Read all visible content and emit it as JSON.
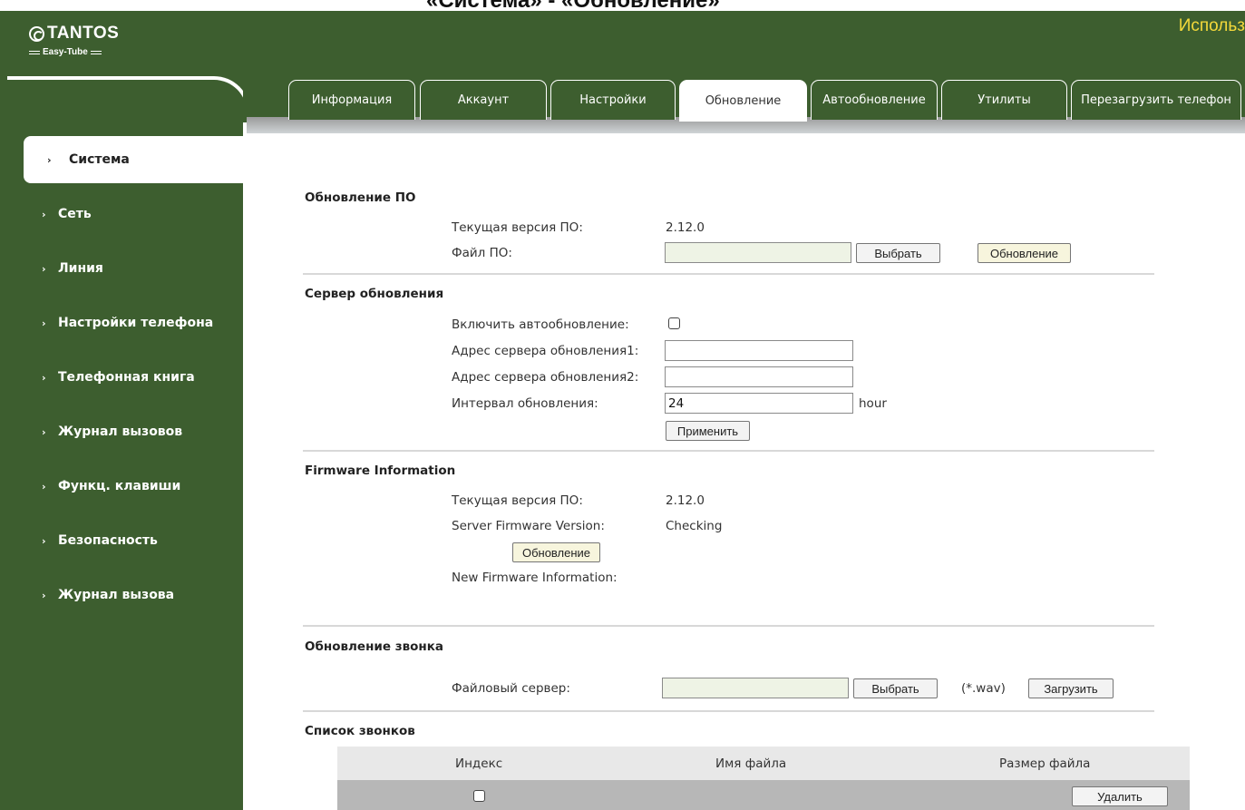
{
  "caption": "«Система» - «Обновление»",
  "header": {
    "brand": "TANTOS",
    "sub_brand": "Easy-Tube",
    "user_label": "Использ"
  },
  "sidebar": {
    "items": [
      {
        "label": "Система",
        "active": true
      },
      {
        "label": "Сеть"
      },
      {
        "label": "Линия"
      },
      {
        "label": "Настройки телефона"
      },
      {
        "label": "Телефонная книга"
      },
      {
        "label": "Журнал вызовов"
      },
      {
        "label": "Функц. клавиши"
      },
      {
        "label": "Безопасность"
      },
      {
        "label": "Журнал вызова"
      }
    ]
  },
  "tabs": [
    {
      "label": "Информация"
    },
    {
      "label": "Аккаунт"
    },
    {
      "label": "Настройки"
    },
    {
      "label": "Обновление",
      "active": true
    },
    {
      "label": "Автообновление"
    },
    {
      "label": "Утилиты"
    },
    {
      "label": "Перезагрузить телефон"
    }
  ],
  "firmware_update": {
    "title": "Обновление ПО",
    "current_version_label": "Текущая версия ПО:",
    "current_version_value": "2.12.0",
    "file_label": "Файл ПО:",
    "file_value": "",
    "choose_button": "Выбрать",
    "update_button": "Обновление"
  },
  "update_server": {
    "title": "Сервер обновления",
    "enable_label": "Включить автообновление:",
    "enable_checked": false,
    "server1_label": "Адрес сервера обновления1:",
    "server1_value": "",
    "server2_label": "Адрес сервера обновления2:",
    "server2_value": "",
    "interval_label": "Интервал обновления:",
    "interval_value": "24",
    "interval_unit": "hour",
    "apply_button": "Применить"
  },
  "firmware_info": {
    "title": "Firmware Information",
    "current_version_label": "Текущая версия ПО:",
    "current_version_value": "2.12.0",
    "server_version_label": "Server Firmware Version:",
    "server_version_value": "Checking",
    "update_button": "Обновление",
    "new_info_label": "New Firmware Information:"
  },
  "ring_update": {
    "title": "Обновление звонка",
    "file_server_label": "Файловый сервер:",
    "file_value": "",
    "choose_button": "Выбрать",
    "ext_hint": "(*.wav)",
    "upload_button": "Загрузить"
  },
  "ring_list": {
    "title": "Список звонков",
    "columns": [
      "Индекс",
      "Имя файла",
      "Размер файла"
    ],
    "delete_button": "Удалить"
  },
  "colors": {
    "header_green": "#3d5e2f",
    "user_label_yellow": "#f4d93a"
  }
}
